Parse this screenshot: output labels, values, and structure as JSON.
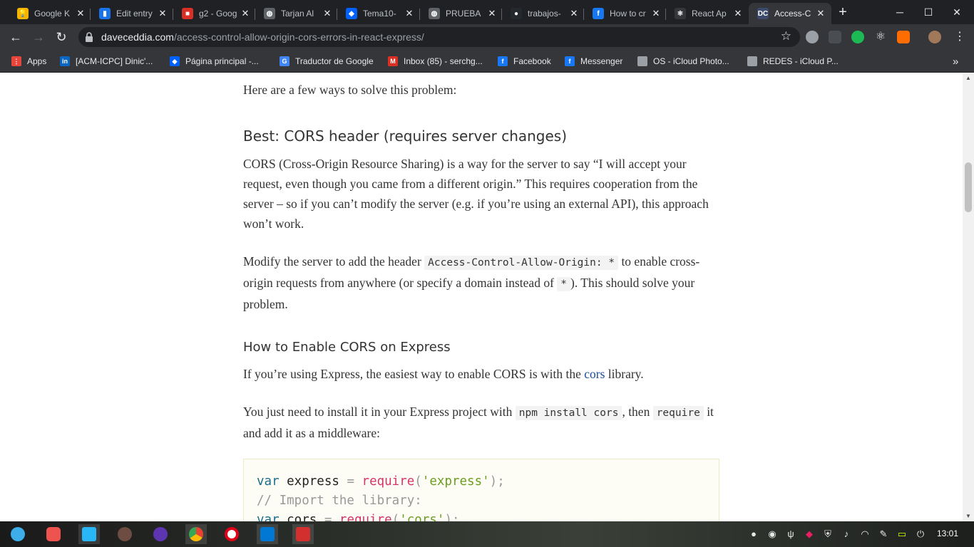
{
  "browser": {
    "tabs": [
      {
        "label": "Google K",
        "favicon_color": "#f4b400",
        "favicon_glyph": "💡",
        "icon": "keep-icon"
      },
      {
        "label": "Edit entry",
        "favicon_color": "#1a73e8",
        "favicon_glyph": "▮",
        "icon": "analytics-icon"
      },
      {
        "label": "g2 - Goog",
        "favicon_color": "#d93025",
        "favicon_glyph": "■",
        "icon": "slides-icon"
      },
      {
        "label": "Tarjan Al",
        "favicon_color": "#5f6368",
        "favicon_glyph": "◍",
        "icon": "globe-icon"
      },
      {
        "label": "Tema10-",
        "favicon_color": "#0061ff",
        "favicon_glyph": "◆",
        "icon": "dropbox-icon"
      },
      {
        "label": "PRUEBA",
        "favicon_color": "#5f6368",
        "favicon_glyph": "◍",
        "icon": "globe-icon"
      },
      {
        "label": "trabajos-",
        "favicon_color": "#24292e",
        "favicon_glyph": "●",
        "icon": "github-icon"
      },
      {
        "label": "How to cr",
        "favicon_color": "#1877f2",
        "favicon_glyph": "f",
        "icon": "freecodecamp-icon"
      },
      {
        "label": "React Ap",
        "favicon_color": "#35363a",
        "favicon_glyph": "⚛",
        "icon": "react-icon"
      },
      {
        "label": "Access-C",
        "favicon_color": "#3c4a6b",
        "favicon_glyph": "DC",
        "icon": "daveceddia-icon",
        "active": true
      }
    ],
    "url_host": "daveceddia.com",
    "url_path": "/access-control-allow-origin-cors-errors-in-react-express/",
    "bookmarks": [
      {
        "label": "Apps",
        "color": "#e8453c",
        "glyph": "⋮"
      },
      {
        "label": "[ACM-ICPC] Dinic'...",
        "color": "#0a66c2",
        "glyph": "in"
      },
      {
        "label": "Página principal -...",
        "color": "#0061ff",
        "glyph": "◆"
      },
      {
        "label": "Traductor de Google",
        "color": "#4285f4",
        "glyph": "G"
      },
      {
        "label": "Inbox (85) - serchg...",
        "color": "#d93025",
        "glyph": "M"
      },
      {
        "label": "Facebook",
        "color": "#1877f2",
        "glyph": "f"
      },
      {
        "label": "Messenger",
        "color": "#1877f2",
        "glyph": "f"
      },
      {
        "label": "OS - iCloud Photo...",
        "color": "#9aa0a6",
        "glyph": ""
      },
      {
        "label": "REDES - iCloud P...",
        "color": "#9aa0a6",
        "glyph": ""
      }
    ],
    "more_bookmarks": "»"
  },
  "article": {
    "intro": "Here are a few ways to solve this problem:",
    "h_best": "Best: CORS header (requires server changes)",
    "p_cors": "CORS (Cross-Origin Resource Sharing) is a way for the server to say “I will accept your request, even though you came from a different origin.” This requires cooperation from the server – so if you can’t modify the server (e.g. if you’re using an external API), this approach won’t work.",
    "p_modify_1": "Modify the server to add the header",
    "code_header": "Access-Control-Allow-Origin: *",
    "p_modify_2": "to enable cross-origin requests from anywhere (or specify a domain instead of",
    "code_star": "*",
    "p_modify_3": "). This should solve your problem.",
    "h_express": "How to Enable CORS on Express",
    "p_express_1": "If you’re using Express, the easiest way to enable CORS is with the",
    "link_cors": "cors",
    "p_express_2": "library.",
    "p_install_1": "You just need to install it in your Express project with",
    "code_npm": "npm install cors",
    "p_install_2": ", then",
    "code_require": "require",
    "p_install_3": "it and add it as a middleware:",
    "code": {
      "l1_kw": "var",
      "l1_name": " express ",
      "l1_eq": "=",
      "l1_fn": "require",
      "l1_open": "(",
      "l1_str": "'express'",
      "l1_close": ");",
      "l2_comment": "// Import the library:",
      "l3_kw": "var",
      "l3_name": " cors ",
      "l3_eq": "=",
      "l3_fn": "require",
      "l3_open": "(",
      "l3_str": "'cors'",
      "l3_close": ");"
    }
  },
  "taskbar": {
    "clock": "13:01"
  }
}
